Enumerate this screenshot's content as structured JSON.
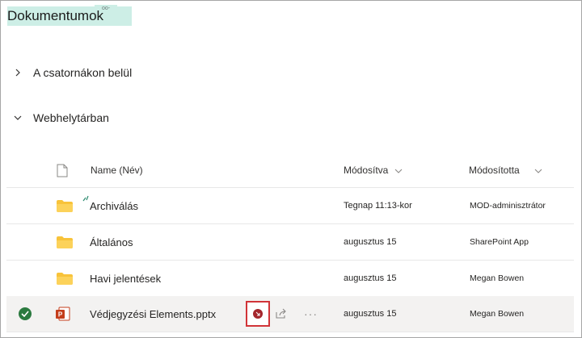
{
  "library": {
    "title": "Dokumentumok",
    "title_tag": "oo-"
  },
  "sections": [
    {
      "label": "A csatornákon belül",
      "state": "collapsed"
    },
    {
      "label": "Webhelytárban",
      "state": "expanded"
    }
  ],
  "table": {
    "headers": {
      "name": "Name (Név)",
      "modified": "Módosítva",
      "modified_by": "Módosította"
    },
    "rows": [
      {
        "icon": "folder-icon",
        "name": "Archiválás",
        "modified": "Tegnap 11:13-kor",
        "modified_by": "MOD-adminisztrátor",
        "selected": false
      },
      {
        "icon": "folder-icon",
        "name": "Általános",
        "modified": "augusztus 15",
        "modified_by": "SharePoint App",
        "selected": false
      },
      {
        "icon": "folder-icon",
        "name": "Havi jelentések",
        "modified": "augusztus 15",
        "modified_by": "Megan Bowen",
        "selected": false
      },
      {
        "icon": "powerpoint-file-icon",
        "name": "Védjegyzési Elements.pptx",
        "modified": "augusztus 15",
        "modified_by": "Megan Bowen",
        "selected": true
      }
    ]
  },
  "colors": {
    "title_highlight": "#cdeee6",
    "folder": "#f8c33a",
    "powerpoint": "#c43e1c",
    "selected_check": "#2b7a3f",
    "action_highlight": "#d13438"
  }
}
